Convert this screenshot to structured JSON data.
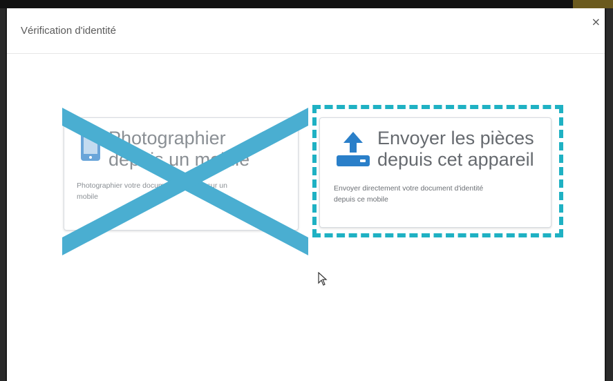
{
  "modal": {
    "title": "Vérification d'identité",
    "close_label": "×"
  },
  "options": [
    {
      "title": "Photographier\ndepuis un mobile",
      "description": "Photographier votre document d'identité sur un\nmobile",
      "icon": "mobile-photo-icon",
      "state": "crossed-out"
    },
    {
      "title": "Envoyer les pièces\ndepuis cet appareil",
      "description": "Envoyer directement votre document d'identité\ndepuis ce mobile",
      "icon": "upload-icon",
      "state": "highlighted"
    }
  ],
  "colors": {
    "accent": "#1fb1c3",
    "cross": "#4aaed1",
    "icon": "#2a7fc9",
    "text": "#666a6f"
  }
}
